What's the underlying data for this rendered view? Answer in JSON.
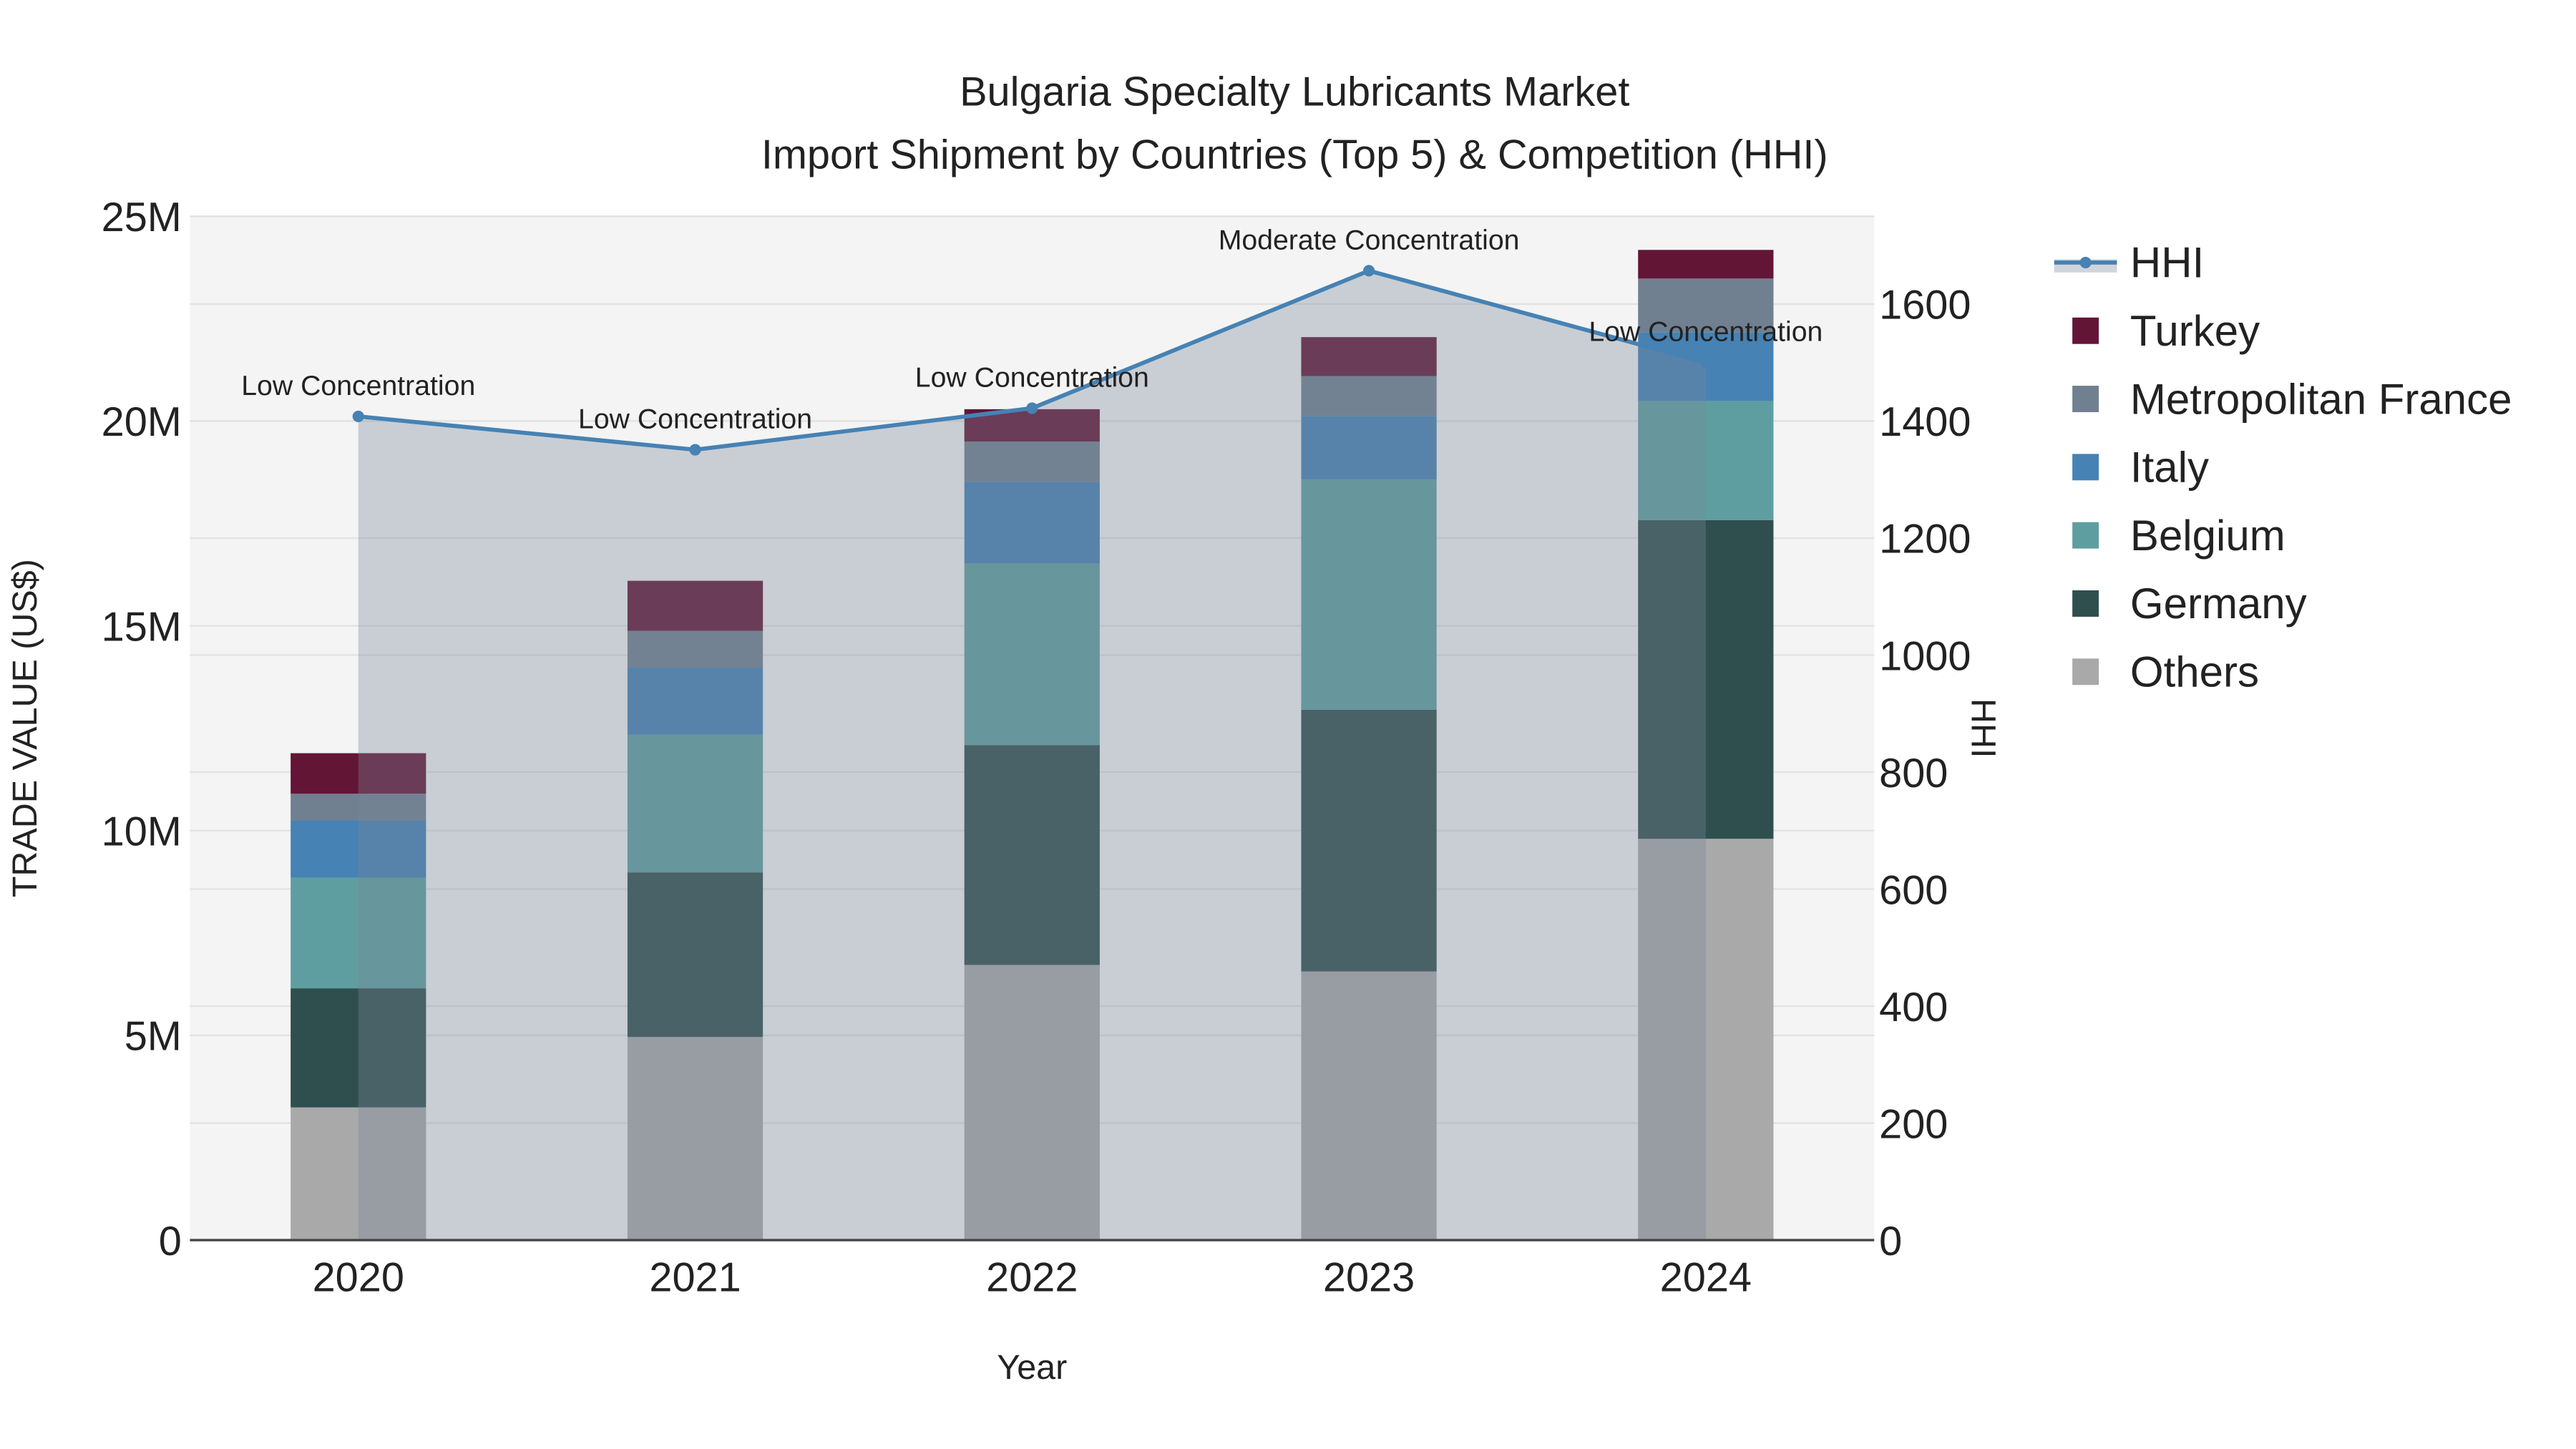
{
  "chart_data": {
    "type": "bar",
    "stacked": true,
    "title": "Bulgaria Specialty Lubricants Market",
    "subtitle": "Import Shipment by Countries (Top 5) & Competition (HHI)",
    "xlabel": "Year",
    "ylabel": "TRADE VALUE (US$)",
    "y2label": "HHI",
    "categories": [
      "2020",
      "2021",
      "2022",
      "2023",
      "2024"
    ],
    "ylim": [
      0,
      25000000
    ],
    "y_ticks": [
      0,
      5000000,
      10000000,
      15000000,
      20000000,
      25000000
    ],
    "y_tick_labels": [
      "0",
      "5M",
      "10M",
      "15M",
      "20M",
      "25M"
    ],
    "y2lim": [
      0,
      1750
    ],
    "y2_ticks": [
      0,
      200,
      400,
      600,
      800,
      1000,
      1200,
      1400,
      1600
    ],
    "y2_tick_labels": [
      "0",
      "200",
      "400",
      "600",
      "800",
      "1000",
      "1200",
      "1400",
      "1600"
    ],
    "grid": true,
    "legend_position": "right",
    "series": [
      {
        "name": "Others",
        "color": "#a9a9a9",
        "values": [
          3240000,
          4960000,
          6720000,
          6560000,
          9800000
        ]
      },
      {
        "name": "Germany",
        "color": "#2f4f4f",
        "values": [
          2910000,
          4020000,
          5370000,
          6390000,
          7780000
        ]
      },
      {
        "name": "Belgium",
        "color": "#5f9ea0",
        "values": [
          2700000,
          3360000,
          4430000,
          5620000,
          2910000
        ]
      },
      {
        "name": "Italy",
        "color": "#4682b4",
        "values": [
          1400000,
          1640000,
          2000000,
          1550000,
          1680000
        ]
      },
      {
        "name": "Metropolitan France",
        "color": "#708090",
        "values": [
          650000,
          900000,
          980000,
          980000,
          1310000
        ]
      },
      {
        "name": "Turkey",
        "color": "#631536",
        "values": [
          990000,
          1220000,
          790000,
          950000,
          700000
        ]
      }
    ],
    "hhi": {
      "name": "HHI",
      "color": "#4682b4",
      "values": [
        1408,
        1351,
        1422,
        1657,
        1500
      ],
      "annotations": [
        "Low Concentration",
        "Low Concentration",
        "Low Concentration",
        "Moderate Concentration",
        "Low Concentration"
      ]
    },
    "legend_order": [
      "HHI",
      "Turkey",
      "Metropolitan France",
      "Italy",
      "Belgium",
      "Germany",
      "Others"
    ]
  }
}
